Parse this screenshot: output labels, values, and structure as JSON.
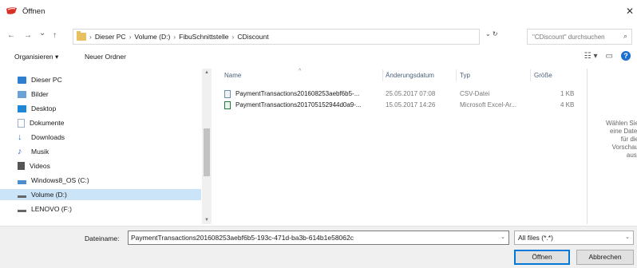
{
  "window": {
    "title": "Öffnen",
    "close_glyph": "✕"
  },
  "nav": {
    "back_glyph": "←",
    "forward_glyph": "→",
    "recent_glyph": "⌄",
    "up_glyph": "↑",
    "breadcrumb": [
      "Dieser PC",
      "Volume (D:)",
      "FibuSchnittstelle",
      "CDiscount"
    ],
    "separator": "›",
    "refresh_glyph": "⌄   ↻",
    "search_placeholder": "\"CDiscount\" durchsuchen",
    "search_glyph": "⌕"
  },
  "toolbar": {
    "organize_label": "Organisieren ▾",
    "new_folder_label": "Neuer Ordner",
    "view_glyph": "☷ ▾",
    "pane_glyph": "▭",
    "help_glyph": "?"
  },
  "sidebar": {
    "items": [
      {
        "label": "Dieser PC",
        "icon": "pc-icon",
        "color": "#2f7fd1"
      },
      {
        "label": "Bilder",
        "icon": "pictures-icon",
        "color": "#6aa2d8"
      },
      {
        "label": "Desktop",
        "icon": "desktop-icon",
        "color": "#1e88d8"
      },
      {
        "label": "Dokumente",
        "icon": "documents-icon",
        "color": "#9ab0c8"
      },
      {
        "label": "Downloads",
        "icon": "downloads-icon",
        "color": "#2e78c8"
      },
      {
        "label": "Musik",
        "icon": "music-icon",
        "color": "#2f6fc0"
      },
      {
        "label": "Videos",
        "icon": "videos-icon",
        "color": "#555555"
      },
      {
        "label": "Windows8_OS (C:)",
        "icon": "drive-c-icon",
        "color": "#4a8ed0"
      },
      {
        "label": "Volume (D:)",
        "icon": "drive-d-icon",
        "color": "#666666"
      },
      {
        "label": "LENOVO (F:)",
        "icon": "drive-f-icon",
        "color": "#666666"
      }
    ],
    "scroll_up_glyph": "▲",
    "scroll_down_glyph": "▼"
  },
  "files": {
    "headers": {
      "name": "Name",
      "date": "Änderungsdatum",
      "type": "Typ",
      "size": "Größe"
    },
    "sort_glyph": "^",
    "rows": [
      {
        "name": "PaymentTransactions201608253aebf6b5-...",
        "date": "25.05.2017 07:08",
        "type": "CSV-Datei",
        "size": "1 KB",
        "icon": "csv-file-icon"
      },
      {
        "name": "PaymentTransactions201705152944d0a9-...",
        "date": "15.05.2017 14:26",
        "type": "Microsoft Excel-Ar...",
        "size": "4 KB",
        "icon": "excel-file-icon"
      }
    ]
  },
  "preview": {
    "text": "Wählen Sie\neine Datei\nfür die\nVorschau\naus."
  },
  "footer": {
    "filename_label": "Dateiname:",
    "filename_value": "PaymentTransactions201608253aebf6b5-193c-471d-ba3b-614b1e58062c",
    "dropdown_glyph": "⌄",
    "filetype_value": "All files (*.*)",
    "open_label": "Öffnen",
    "cancel_label": "Abbrechen"
  },
  "colors": {
    "accent": "#0078d7",
    "selection": "#cce4f7",
    "header_text": "#4c607a"
  }
}
